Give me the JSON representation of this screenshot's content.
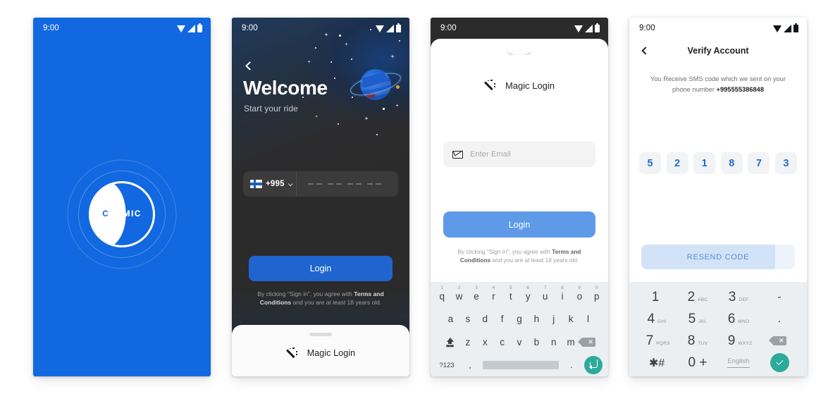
{
  "status_bar": {
    "time": "9:00",
    "icons": [
      "wifi-icon",
      "signal-icon",
      "battery-icon"
    ]
  },
  "screens": [
    {
      "id": "splash",
      "name": "Splash Screen",
      "brand": "COSMIC",
      "background_color": "#1268e0",
      "logo_icon": "crescent-moon-icon"
    },
    {
      "id": "welcome",
      "name": "Welcome / Phone Login",
      "back_icon": "back-chevron-icon",
      "heading": "Welcome",
      "subheading": "Start your ride",
      "country_code": "+995",
      "country_flag": "finland-flag-icon",
      "phone_placeholder": "--- -- -- --",
      "login_label": "Login",
      "terms_line1": "By clicking \"Sign in\", you agree with",
      "terms_bold": "Terms and Conditions",
      "terms_line2": " and you are at least 18 years old.",
      "sheet_label": "Magic Login",
      "sheet_icon": "magic-wand-icon",
      "accent_color": "#1f64cf"
    },
    {
      "id": "magic_login",
      "name": "Magic Login Sheet",
      "title": "Magic Login",
      "title_icon": "magic-wand-icon",
      "email_icon": "envelope-icon",
      "email_placeholder": "Enter Email",
      "email_value": "",
      "login_label": "Login",
      "terms_line1": "By clicking \"Sign in\", you agree with",
      "terms_bold": "Terms and Conditions",
      "terms_line2": " and you are at least 18 years old.",
      "accent_color": "#5e9ae8",
      "keyboard": {
        "row1": [
          {
            "key": "q",
            "num": "1"
          },
          {
            "key": "w",
            "num": "2"
          },
          {
            "key": "e",
            "num": "3"
          },
          {
            "key": "r",
            "num": "4"
          },
          {
            "key": "t",
            "num": "5"
          },
          {
            "key": "y",
            "num": "6"
          },
          {
            "key": "u",
            "num": "7"
          },
          {
            "key": "i",
            "num": "8"
          },
          {
            "key": "o",
            "num": "9"
          },
          {
            "key": "p",
            "num": "0"
          }
        ],
        "row2": [
          "a",
          "s",
          "d",
          "f",
          "g",
          "h",
          "j",
          "k",
          "l"
        ],
        "row3": [
          "z",
          "x",
          "c",
          "v",
          "b",
          "n",
          "m"
        ],
        "shift_icon": "shift-icon",
        "backspace_icon": "backspace-icon",
        "symbols_key": "?123",
        "comma_key": ",",
        "period_key": ".",
        "enter_icon": "enter-icon",
        "enter_color": "#2cab9c"
      }
    },
    {
      "id": "verify",
      "name": "Verify Account",
      "back_icon": "back-chevron-icon",
      "title": "Verify Account",
      "desc_line1": "You Receive SMS code which we sent on",
      "desc_line2": "your phone number ",
      "phone_number": "+995555386848",
      "otp_digits": [
        "5",
        "2",
        "1",
        "8",
        "7",
        "3"
      ],
      "resend_label": "RESEND CODE",
      "resend_progress": 87,
      "otp_color": "#1d6fd0",
      "numpad": {
        "keys": [
          [
            {
              "num": "1",
              "sub": ""
            },
            {
              "num": "2",
              "sub": "ABC"
            },
            {
              "num": "3",
              "sub": "DEF"
            },
            {
              "num": "-",
              "sub": ""
            }
          ],
          [
            {
              "num": "4",
              "sub": "GHI"
            },
            {
              "num": "5",
              "sub": "JKL"
            },
            {
              "num": "6",
              "sub": "MNO"
            },
            {
              "num": ".",
              "sub": ""
            }
          ],
          [
            {
              "num": "7",
              "sub": "PQRS"
            },
            {
              "num": "8",
              "sub": "TUV"
            },
            {
              "num": "9",
              "sub": "WXYZ"
            },
            {
              "num": "backspace-icon",
              "sub": ""
            }
          ],
          [
            {
              "num": "✱#",
              "sub": ""
            },
            {
              "num": "0 +",
              "sub": ""
            },
            {
              "num": "English",
              "sub": ""
            },
            {
              "num": "check-icon",
              "sub": ""
            }
          ]
        ],
        "language_label": "English",
        "star_hash": "✱#",
        "zero_plus": "0 +",
        "confirm_icon": "check-icon",
        "confirm_color": "#2cab9c"
      }
    }
  ]
}
